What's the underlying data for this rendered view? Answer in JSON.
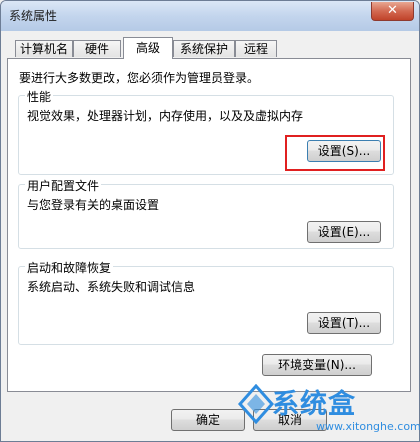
{
  "window": {
    "title": "系统属性",
    "close_symbol": "✕"
  },
  "tabs": [
    {
      "label": "计算机名",
      "active": false
    },
    {
      "label": "硬件",
      "active": false
    },
    {
      "label": "高级",
      "active": true
    },
    {
      "label": "系统保护",
      "active": false
    },
    {
      "label": "远程",
      "active": false
    }
  ],
  "panel": {
    "admin_note": "要进行大多数更改，您必须作为管理员登录。",
    "performance": {
      "title": "性能",
      "description": "视觉效果，处理器计划，内存使用，以及及虚拟内存",
      "button": "设置(S)..."
    },
    "user_profiles": {
      "title": "用户配置文件",
      "description": "与您登录有关的桌面设置",
      "button": "设置(E)..."
    },
    "startup_recovery": {
      "title": "启动和故障恢复",
      "description": "系统启动、系统失败和调试信息",
      "button": "设置(T)..."
    },
    "env_button": "环境变量(N)..."
  },
  "footer": {
    "ok": "确定",
    "cancel": "取消"
  },
  "watermark": {
    "name": "系统盒",
    "url": "www.xitonghe.com"
  },
  "colors": {
    "highlight": "#e02020",
    "watermark": "#2f8de0"
  }
}
